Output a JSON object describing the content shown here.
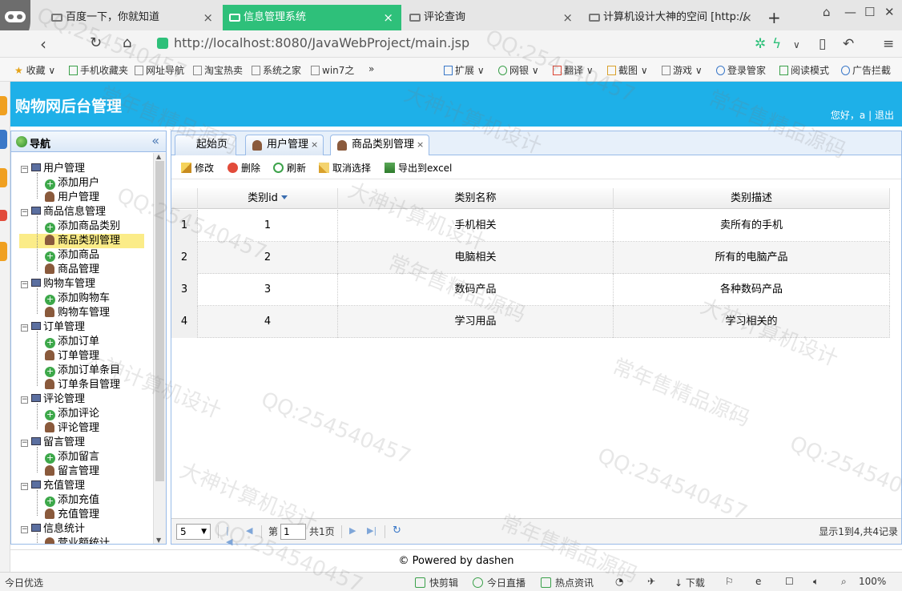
{
  "browser": {
    "tabs": [
      {
        "title": "百度一下，你就知道",
        "active": false
      },
      {
        "title": "信息管理系统",
        "active": true
      },
      {
        "title": "评论查询",
        "active": false
      },
      {
        "title": "计算机设计大神的空间 [http://",
        "active": false
      }
    ],
    "url": "http://localhost:8080/JavaWebProject/main.jsp",
    "bookmarks": [
      "收藏",
      "手机收藏夹",
      "网址导航",
      "淘宝热卖",
      "系统之家",
      "win7之",
      "扩展",
      "网银",
      "翻译",
      "截图",
      "游戏",
      "登录管家",
      "阅读模式",
      "广告拦截"
    ],
    "status": {
      "left": "今日优选",
      "items": [
        "快剪辑",
        "今日直播",
        "热点资讯",
        "下载"
      ],
      "zoom": "100%"
    }
  },
  "app": {
    "title": "购物网后台管理",
    "greeting": "您好，a",
    "separator": "|",
    "logout": "退出",
    "footer": "© Powered by dashen"
  },
  "nav": {
    "title": "导航",
    "groups": [
      {
        "label": "用户管理",
        "children": [
          "添加用户",
          "用户管理"
        ]
      },
      {
        "label": "商品信息管理",
        "children": [
          "添加商品类别",
          "商品类别管理",
          "添加商品",
          "商品管理"
        ]
      },
      {
        "label": "购物车管理",
        "children": [
          "添加购物车",
          "购物车管理"
        ]
      },
      {
        "label": "订单管理",
        "children": [
          "添加订单",
          "订单管理",
          "添加订单条目",
          "订单条目管理"
        ]
      },
      {
        "label": "评论管理",
        "children": [
          "添加评论",
          "评论管理"
        ]
      },
      {
        "label": "留言管理",
        "children": [
          "添加留言",
          "留言管理"
        ]
      },
      {
        "label": "充值管理",
        "children": [
          "添加充值",
          "充值管理"
        ]
      },
      {
        "label": "信息统计",
        "children": [
          "营业额统计"
        ]
      }
    ],
    "selected": "商品类别管理"
  },
  "tabs": [
    {
      "label": "起始页",
      "closable": false
    },
    {
      "label": "用户管理",
      "closable": true
    },
    {
      "label": "商品类别管理",
      "closable": true,
      "active": true
    }
  ],
  "toolbar": {
    "edit": "修改",
    "delete": "删除",
    "refresh": "刷新",
    "cancel_select": "取消选择",
    "export": "导出到excel"
  },
  "grid": {
    "columns": [
      "类别id",
      "类别名称",
      "类别描述"
    ],
    "rows": [
      {
        "n": "1",
        "id": "1",
        "name": "手机相关",
        "desc": "卖所有的手机"
      },
      {
        "n": "2",
        "id": "2",
        "name": "电脑相关",
        "desc": "所有的电脑产品"
      },
      {
        "n": "3",
        "id": "3",
        "name": "数码产品",
        "desc": "各种数码产品"
      },
      {
        "n": "4",
        "id": "4",
        "name": "学习用品",
        "desc": "学习相关的"
      }
    ]
  },
  "pager": {
    "page_size": "5",
    "page_prefix": "第",
    "page_value": "1",
    "page_suffix": "共1页",
    "summary": "显示1到4,共4记录"
  },
  "watermark": {
    "lines": [
      "QQ:254540457",
      "大神计算机设计",
      "常年售精品源码"
    ]
  }
}
